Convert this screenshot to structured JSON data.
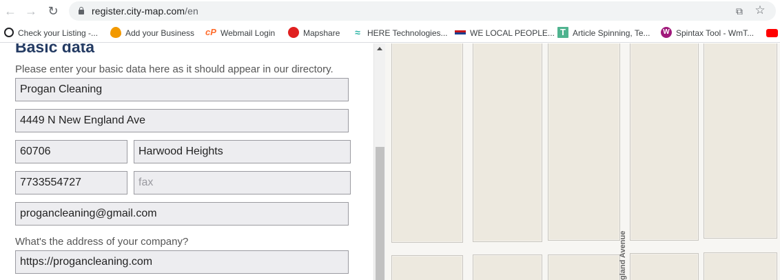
{
  "browser": {
    "url_host": "register.city-map.com",
    "url_path": "/en",
    "bookmarks": [
      {
        "label": "Check your Listing -...",
        "icon": "circle-outline-icon",
        "color": "#202124"
      },
      {
        "label": "Add your Business",
        "icon": "bulb-icon",
        "color": "#f29900"
      },
      {
        "label": "Webmail Login",
        "icon": "cpanel-icon",
        "color": "#ff6c2c"
      },
      {
        "label": "Mapshare",
        "icon": "mapshare-icon",
        "color": "#e02020"
      },
      {
        "label": "HERE Technologies...",
        "icon": "here-icon",
        "color": "#2cb5a5"
      },
      {
        "label": "WE LOCAL PEOPLE...",
        "icon": "flag-icon",
        "color": "#c4161c"
      },
      {
        "label": "Article Spinning, Te...",
        "icon": "t-icon",
        "color": "#4fb38f"
      },
      {
        "label": "Spintax Tool - WmT...",
        "icon": "spintax-icon",
        "color": "#a0197b"
      },
      {
        "label": "",
        "icon": "youtube-icon",
        "color": "#ff0000"
      }
    ]
  },
  "form": {
    "section_title": "Basic data",
    "intro": "Please enter your basic data here as it should appear in our directory.",
    "company_name": "Progan Cleaning",
    "street": "4449 N New England Ave",
    "zip": "60706",
    "city": "Harwood Heights",
    "phone": "7733554727",
    "fax_placeholder": "fax",
    "email": "progancleaning@gmail.com",
    "website_question": "What's the address of your company?",
    "website": "https://progancleaning.com"
  },
  "map": {
    "street_label": "gland Avenue"
  }
}
